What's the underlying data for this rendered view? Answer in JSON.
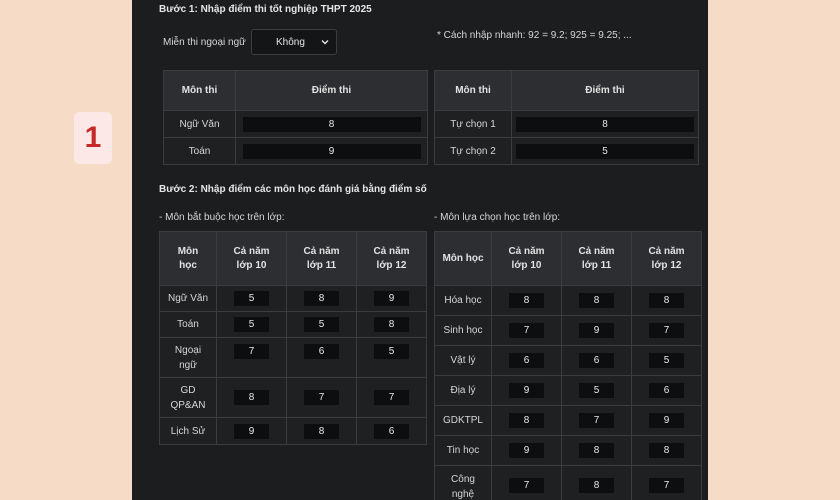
{
  "step_badge": "1",
  "step1": {
    "title": "Bước 1: Nhập điểm thi tốt nghiệp THPT 2025",
    "exempt_label": "Miễn thi ngoại ngữ",
    "exempt_value": "Không",
    "hint": "* Cách nhập nhanh: 92 = 9.2; 925 = 9.25; ...",
    "left_table": {
      "headers": [
        "Môn thi",
        "Điểm thi"
      ],
      "rows": [
        {
          "subject": "Ngữ Văn",
          "score": "8"
        },
        {
          "subject": "Toán",
          "score": "9"
        }
      ]
    },
    "right_table": {
      "headers": [
        "Môn thi",
        "Điểm thi"
      ],
      "rows": [
        {
          "subject": "Tự chọn 1",
          "score": "8"
        },
        {
          "subject": "Tự chọn 2",
          "score": "5"
        }
      ]
    }
  },
  "step2": {
    "title": "Bước 2: Nhập điểm các môn học đánh giá bằng điểm số",
    "required_label": "- Môn bắt buộc học trên lớp:",
    "elective_label": "- Môn lựa chọn học trên lớp:",
    "required_table": {
      "headers": {
        "subject": [
          "Môn",
          "học"
        ],
        "g10": [
          "Cả năm",
          "lớp 10"
        ],
        "g11": [
          "Cả năm",
          "lớp 11"
        ],
        "g12": [
          "Cả năm",
          "lớp 12"
        ]
      },
      "rows": [
        {
          "subject": [
            "Ngữ Văn"
          ],
          "g10": "5",
          "g11": "8",
          "g12": "9"
        },
        {
          "subject": [
            "Toán"
          ],
          "g10": "5",
          "g11": "5",
          "g12": "8"
        },
        {
          "subject": [
            "Ngoại",
            "ngữ"
          ],
          "g10": "7",
          "g11": "6",
          "g12": "5"
        },
        {
          "subject": [
            "GD",
            "QP&AN"
          ],
          "g10": "8",
          "g11": "7",
          "g12": "7"
        },
        {
          "subject": [
            "Lịch Sử"
          ],
          "g10": "9",
          "g11": "8",
          "g12": "6"
        }
      ]
    },
    "elective_table": {
      "headers": {
        "subject": "Môn học",
        "g10": [
          "Cả năm",
          "lớp 10"
        ],
        "g11": [
          "Cả năm",
          "lớp 11"
        ],
        "g12": [
          "Cả năm",
          "lớp 12"
        ]
      },
      "rows": [
        {
          "subject": [
            "Hóa học"
          ],
          "g10": "8",
          "g11": "8",
          "g12": "8"
        },
        {
          "subject": [
            "Sinh học"
          ],
          "g10": "7",
          "g11": "9",
          "g12": "7"
        },
        {
          "subject": [
            "Vật lý"
          ],
          "g10": "6",
          "g11": "6",
          "g12": "5"
        },
        {
          "subject": [
            "Địa lý"
          ],
          "g10": "9",
          "g11": "5",
          "g12": "6"
        },
        {
          "subject": [
            "GDKTPL"
          ],
          "g10": "8",
          "g11": "7",
          "g12": "9"
        },
        {
          "subject": [
            "Tin học"
          ],
          "g10": "9",
          "g11": "8",
          "g12": "8"
        },
        {
          "subject": [
            "Công",
            "nghệ"
          ],
          "g10": "7",
          "g11": "8",
          "g12": "7"
        }
      ]
    }
  }
}
